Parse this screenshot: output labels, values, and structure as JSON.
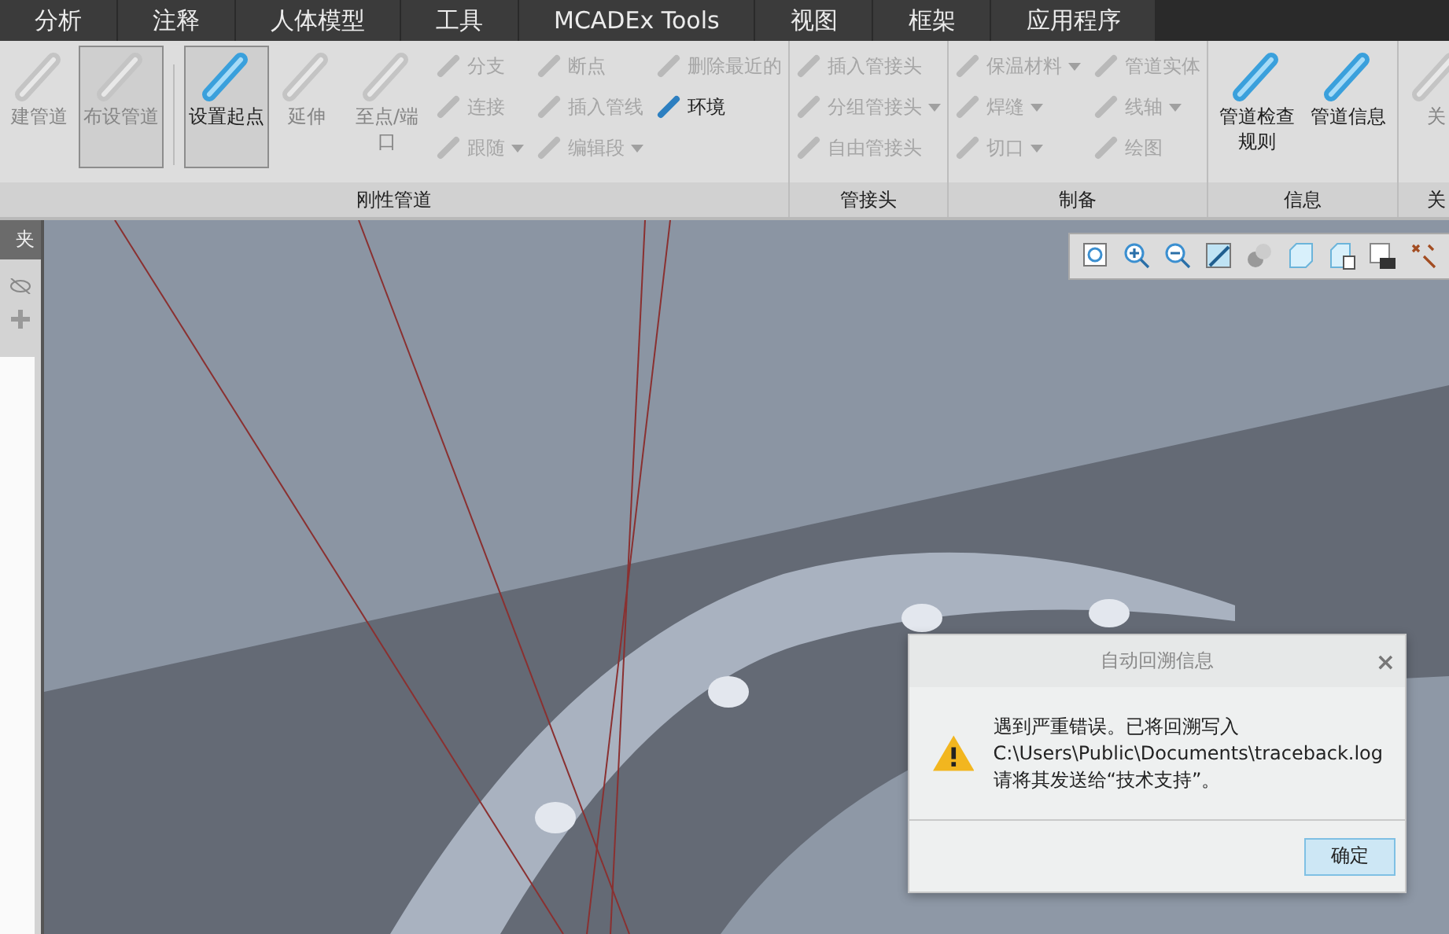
{
  "tabs": [
    "分析",
    "注释",
    "人体模型",
    "工具",
    "MCADEx Tools",
    "视图",
    "框架",
    "应用程序"
  ],
  "ribbon": {
    "groups": [
      {
        "label": "刚性管道",
        "items": [
          {
            "label": "建管道",
            "kind": "large",
            "disabled": true,
            "selected": false
          },
          {
            "label": "布设管道",
            "kind": "large",
            "disabled": true,
            "selected": true
          },
          {
            "kind": "separator"
          },
          {
            "label": "设置起点",
            "kind": "large",
            "disabled": false,
            "selected": true
          },
          {
            "label": "延伸",
            "kind": "large",
            "disabled": true,
            "selected": false
          },
          {
            "label": "至点/端口",
            "kind": "large",
            "disabled": true,
            "selected": false
          },
          {
            "label": "分支",
            "kind": "small",
            "disabled": true,
            "dropdown": false
          },
          {
            "label": "连接",
            "kind": "small",
            "disabled": true,
            "dropdown": false
          },
          {
            "label": "跟随",
            "kind": "small",
            "disabled": true,
            "dropdown": true
          },
          {
            "label": "断点",
            "kind": "small",
            "disabled": true,
            "dropdown": false
          },
          {
            "label": "插入管线",
            "kind": "small",
            "disabled": true,
            "dropdown": false
          },
          {
            "label": "编辑段",
            "kind": "small",
            "disabled": true,
            "dropdown": true
          },
          {
            "label": "删除最近的",
            "kind": "small",
            "disabled": true,
            "dropdown": false
          },
          {
            "label": "环境",
            "kind": "small",
            "disabled": false,
            "dropdown": false
          }
        ]
      },
      {
        "label": "管接头",
        "items": [
          {
            "label": "插入管接头",
            "kind": "small",
            "disabled": true,
            "dropdown": false
          },
          {
            "label": "分组管接头",
            "kind": "small",
            "disabled": true,
            "dropdown": true
          },
          {
            "label": "自由管接头",
            "kind": "small",
            "disabled": true,
            "dropdown": false
          }
        ]
      },
      {
        "label": "制备",
        "items": [
          {
            "label": "保温材料",
            "kind": "small",
            "disabled": true,
            "dropdown": true
          },
          {
            "label": "焊缝",
            "kind": "small",
            "disabled": true,
            "dropdown": true
          },
          {
            "label": "切口",
            "kind": "small",
            "disabled": true,
            "dropdown": true
          },
          {
            "label": "管道实体",
            "kind": "small",
            "disabled": true,
            "dropdown": false
          },
          {
            "label": "线轴",
            "kind": "small",
            "disabled": true,
            "dropdown": true
          },
          {
            "label": "绘图",
            "kind": "small",
            "disabled": true,
            "dropdown": false
          }
        ]
      },
      {
        "label": "信息",
        "items": [
          {
            "label": "管道检查规则",
            "kind": "large",
            "disabled": false,
            "selected": false
          },
          {
            "label": "管道信息",
            "kind": "large",
            "disabled": false,
            "selected": false
          }
        ]
      },
      {
        "label": "关",
        "items": [
          {
            "label": "关",
            "kind": "large",
            "disabled": true,
            "selected": false
          }
        ]
      }
    ]
  },
  "side_panel": {
    "title": "夹"
  },
  "dialog": {
    "title": "自动回溯信息",
    "close": "×",
    "message": [
      "遇到严重错误。已将回溯写入",
      "C:\\Users\\Public\\Documents\\traceback.log",
      "请将其发送给“技术支持”。"
    ],
    "button": "确定"
  }
}
